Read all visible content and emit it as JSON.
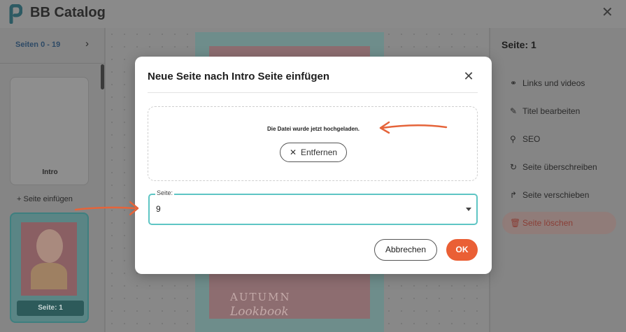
{
  "app": {
    "title": "BB Catalog",
    "close_icon": "close-icon"
  },
  "left_panel": {
    "pages_range": "Seiten 0 - 19",
    "chevron": "›",
    "intro_label": "Intro",
    "insert_page": "+ Seite einfügen",
    "page1_label": "Seite: 1"
  },
  "canvas": {
    "cover_line1": "AUTUMN",
    "cover_line2": "Lookbook"
  },
  "right_panel": {
    "title": "Seite: 1",
    "items": [
      {
        "label": "Links und videos",
        "icon": "link-icon"
      },
      {
        "label": "Titel bearbeiten",
        "icon": "pencil-icon"
      },
      {
        "label": "SEO",
        "icon": "search-icon"
      },
      {
        "label": "Seite überschreiben",
        "icon": "refresh-icon"
      },
      {
        "label": "Seite verschieben",
        "icon": "move-icon"
      },
      {
        "label": "Seite löschen",
        "icon": "trash-icon"
      }
    ]
  },
  "modal": {
    "title": "Neue Seite nach Intro Seite einfügen",
    "upload_message": "Die Datei wurde jetzt hochgeladen.",
    "remove_label": "Entfernen",
    "select_legend": "Seite:",
    "select_value": "9",
    "cancel_label": "Abbrechen",
    "ok_label": "OK"
  },
  "colors": {
    "accent_teal": "#5ec5c4",
    "ok_orange": "#ea5f35",
    "arrow_orange": "#e5643a"
  }
}
